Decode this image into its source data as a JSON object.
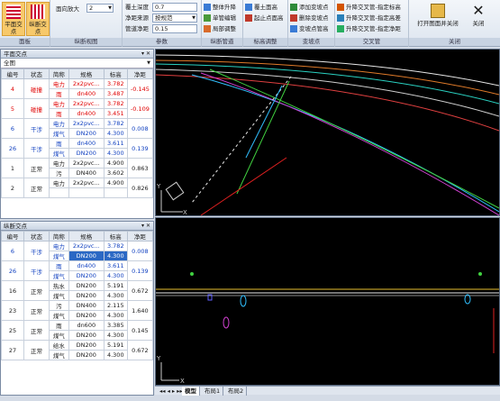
{
  "ribbon": {
    "plan_label": "平面交点",
    "profile_label": "纵断交点",
    "group_panel": "面板",
    "group_profile": "纵断视图",
    "group_params": "参数",
    "scale_label": "面向放大",
    "scale_value": "2",
    "cover_depth_label": "覆土深度",
    "cover_depth_value": "0.7",
    "clear_source_label": "净距来源",
    "clear_source_value": "按规范",
    "pipe_clear_label": "管道净距",
    "pipe_clear_value": "0.15",
    "lift": "整体升降",
    "single_edit": "单管编辑",
    "local_adjust": "局部调整",
    "group_pipe_edit": "纵断管道",
    "cover_high": "覆土面高",
    "start_end_high": "起止点面高",
    "group_elev": "标高调整",
    "add_point": "添加变坡点",
    "del_point": "删除变坡点",
    "change_point": "变坡点管高",
    "group_slope": "变坡点",
    "lift_cross1": "升降交叉管-指定标高",
    "lift_cross2": "升降交叉管-指定高差",
    "lift_cross3": "升降交叉管-指定净距",
    "group_cross": "交叉管",
    "dwg_label": "打开图面并关闭",
    "close_label": "关闭",
    "group_close": "关闭"
  },
  "plan_panel": {
    "title": "平面交点",
    "filter": "全图",
    "headers": [
      "编号",
      "状态",
      "简称",
      "规格",
      "标高",
      "净距"
    ],
    "rows": [
      {
        "id": "4",
        "status": "碰撞",
        "type1": "电力",
        "spec1": "2x2pvc...",
        "elev1": "3.782",
        "type2": "雨",
        "spec2": "dn400",
        "elev2": "3.487",
        "dist": "-0.145",
        "cls": "red"
      },
      {
        "id": "5",
        "status": "碰撞",
        "type1": "电力",
        "spec1": "2x2pvc...",
        "elev1": "3.782",
        "type2": "雨",
        "spec2": "dn400",
        "elev2": "3.451",
        "dist": "-0.109",
        "cls": "red"
      },
      {
        "id": "6",
        "status": "干涉",
        "type1": "电力",
        "spec1": "2x2pvc...",
        "elev1": "3.782",
        "type2": "煤气",
        "spec2": "DN200",
        "elev2": "4.300",
        "dist": "0.008",
        "cls": "blue"
      },
      {
        "id": "26",
        "status": "干涉",
        "type1": "雨",
        "spec1": "dn400",
        "elev1": "3.611",
        "type2": "煤气",
        "spec2": "DN200",
        "elev2": "4.300",
        "dist": "0.139",
        "cls": "blue"
      },
      {
        "id": "1",
        "status": "正常",
        "type1": "电力",
        "spec1": "2x2pvc...",
        "elev1": "4.900",
        "type2": "污",
        "spec2": "DN400",
        "elev2": "3.602",
        "dist": "0.863",
        "cls": ""
      },
      {
        "id": "2",
        "status": "正常",
        "type1": "电力",
        "spec1": "2x2pvc...",
        "elev1": "4.900",
        "type2": "",
        "spec2": "",
        "elev2": "",
        "dist": "0.826",
        "cls": ""
      }
    ]
  },
  "profile_panel": {
    "title": "纵断交点",
    "headers": [
      "编号",
      "状态",
      "简称",
      "规格",
      "标高",
      "净距"
    ],
    "rows": [
      {
        "id": "6",
        "status": "干涉",
        "type1": "电力",
        "spec1": "2x2pvc...",
        "elev1": "3.782",
        "type2": "煤气",
        "spec2": "DN200",
        "elev2": "4.300",
        "dist": "0.008",
        "cls": "blue"
      },
      {
        "id": "26",
        "status": "干涉",
        "type1": "雨",
        "spec1": "dn400",
        "elev1": "3.611",
        "type2": "煤气",
        "spec2": "DN200",
        "elev2": "4.300",
        "dist": "0.139",
        "cls": "blue"
      },
      {
        "id": "16",
        "status": "正常",
        "type1": "热水",
        "spec1": "DN200",
        "elev1": "5.191",
        "type2": "煤气",
        "spec2": "DN200",
        "elev2": "4.300",
        "dist": "0.672",
        "cls": ""
      },
      {
        "id": "23",
        "status": "正常",
        "type1": "污",
        "spec1": "DN400",
        "elev1": "2.115",
        "type2": "煤气",
        "spec2": "DN200",
        "elev2": "4.300",
        "dist": "1.640",
        "cls": ""
      },
      {
        "id": "25",
        "status": "正常",
        "type1": "雨",
        "spec1": "dn600",
        "elev1": "3.385",
        "type2": "煤气",
        "spec2": "DN200",
        "elev2": "4.300",
        "dist": "0.145",
        "cls": ""
      },
      {
        "id": "27",
        "status": "正常",
        "type1": "给水",
        "spec1": "DN200",
        "elev1": "5.191",
        "type2": "煤气",
        "spec2": "DN200",
        "elev2": "4.300",
        "dist": "0.672",
        "cls": ""
      }
    ]
  },
  "tabs": {
    "model": "模型",
    "layout1": "布局1",
    "layout2": "布局2"
  },
  "axis": {
    "x": "X",
    "y": "Y"
  }
}
